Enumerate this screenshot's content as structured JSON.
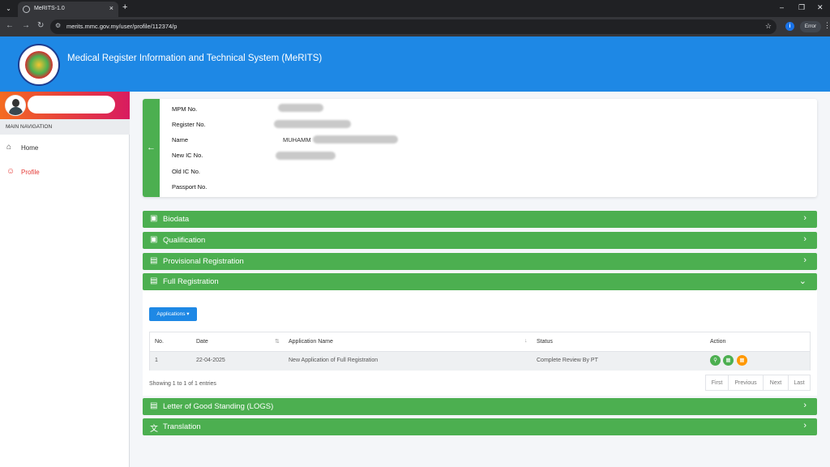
{
  "browser": {
    "tab_title": "MeRITS-1.0",
    "url": "merits.mmc.gov.my/user/profile/112374/p",
    "error_label": "Error"
  },
  "app": {
    "title": "Medical Register Information and Technical System (MeRITS)"
  },
  "sidebar": {
    "nav_header": "MAIN NAVIGATION",
    "items": [
      {
        "label": "Home",
        "icon": "home-icon"
      },
      {
        "label": "Profile",
        "icon": "profile-icon"
      }
    ]
  },
  "profile": {
    "fields": [
      {
        "label": "MPM No."
      },
      {
        "label": "Register No."
      },
      {
        "label": "Name",
        "value": "MUHAMM"
      },
      {
        "label": "New IC No."
      },
      {
        "label": "Old IC No."
      },
      {
        "label": "Passport No."
      }
    ]
  },
  "sections": {
    "biodata": "Biodata",
    "qualification": "Qualification",
    "provisional": "Provisional Registration",
    "full": "Full Registration",
    "logs": "Letter of Good Standing (LOGS)",
    "translation": "Translation"
  },
  "full_registration": {
    "applications_button": "Applications",
    "columns": [
      "No.",
      "Date",
      "Application Name",
      "Status",
      "Action"
    ],
    "rows": [
      {
        "no": "1",
        "date": "22-04-2025",
        "name": "New Application of Full Registration",
        "status": "Complete Review By PT"
      }
    ],
    "info": "Showing 1 to 1 of 1 entries",
    "pager": [
      "First",
      "Previous",
      "Next",
      "Last"
    ]
  },
  "colors": {
    "header_blue": "#1e88e5",
    "section_green": "#4caf50",
    "active_red": "#e53935",
    "action_orange": "#ff9800"
  }
}
